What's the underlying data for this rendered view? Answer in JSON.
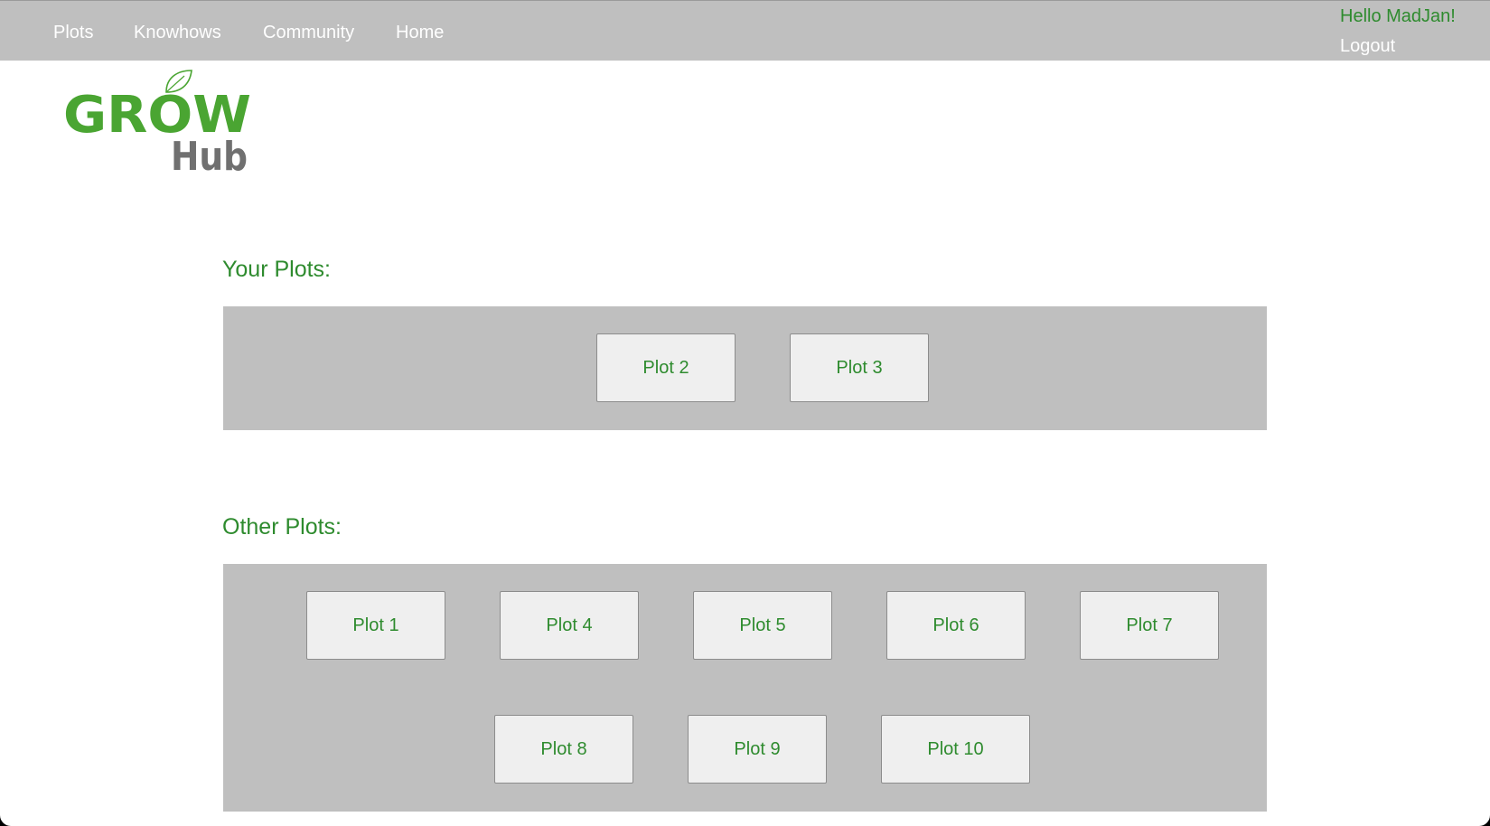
{
  "nav": {
    "items": [
      {
        "label": "Plots"
      },
      {
        "label": "Knowhows"
      },
      {
        "label": "Community"
      },
      {
        "label": "Home"
      }
    ]
  },
  "user": {
    "greeting": "Hello MadJan!",
    "logout_label": "Logout"
  },
  "logo": {
    "line1": "GROW",
    "line2": "Hub",
    "icon": "leaf-icon"
  },
  "your_plots": {
    "title": "Your Plots:",
    "plots": [
      "Plot 2",
      "Plot 3"
    ]
  },
  "other_plots": {
    "title": "Other Plots:",
    "plots": [
      "Plot 1",
      "Plot 4",
      "Plot 5",
      "Plot 6",
      "Plot 7",
      "Plot 8",
      "Plot 9",
      "Plot 10"
    ]
  },
  "colors": {
    "brand_green": "#2e8b2e",
    "logo_green": "#4aa532",
    "logo_gray": "#707070",
    "bar_gray": "#bfbfbf",
    "card_bg": "#efefef"
  }
}
